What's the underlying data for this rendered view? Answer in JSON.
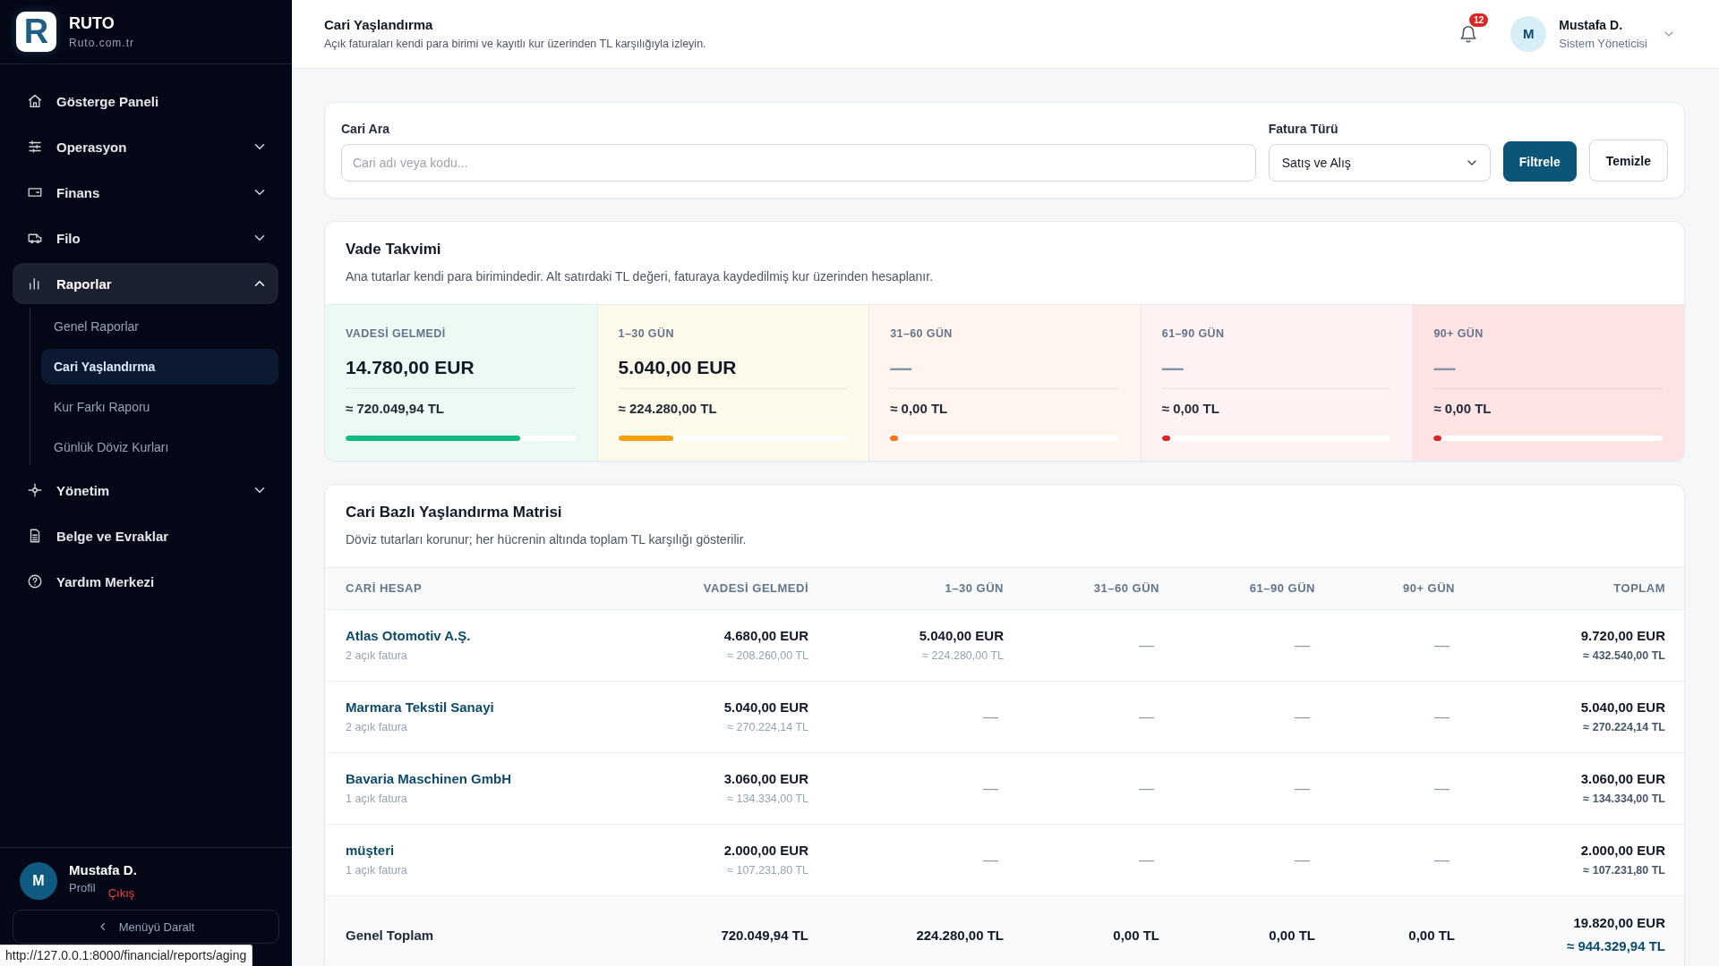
{
  "sidebar": {
    "brand": {
      "logo_letter": "R",
      "name": "RUTO",
      "domain": "Ruto.com.tr"
    },
    "items": [
      {
        "kind": "link",
        "label": "Gösterge Paneli",
        "selected": false
      },
      {
        "kind": "group",
        "label": "Operasyon",
        "selected": false,
        "expanded": false
      },
      {
        "kind": "group",
        "label": "Finans",
        "selected": false,
        "expanded": false
      },
      {
        "kind": "group",
        "label": "Filo",
        "selected": false,
        "expanded": false
      },
      {
        "kind": "group",
        "label": "Raporlar",
        "selected": true,
        "expanded": true,
        "children": [
          {
            "label": "Genel Raporlar",
            "selected": false
          },
          {
            "label": "Cari Yaşlandırma",
            "selected": true
          },
          {
            "label": "Kur Farkı Raporu",
            "selected": false
          },
          {
            "label": "Günlük Döviz Kurları",
            "selected": false
          }
        ]
      },
      {
        "kind": "group",
        "label": "Yönetim",
        "selected": false,
        "expanded": false
      },
      {
        "kind": "link",
        "label": "Belge ve Evraklar",
        "selected": false
      },
      {
        "kind": "link",
        "label": "Yardım Merkezi",
        "selected": false
      }
    ],
    "user": {
      "initial": "M",
      "name": "Mustafa D.",
      "profile_link": "Profil",
      "logout_link": "Çıkış"
    },
    "collapse_button": "Menüyü Daralt"
  },
  "header": {
    "title": "Cari Yaşlandırma",
    "subtitle": "Açık faturaları kendi para birimi ve kayıtlı kur üzerinden TL karşılığıyla izleyin.",
    "notifications": {
      "count": "12"
    },
    "user": {
      "initial": "M",
      "name": "Mustafa D.",
      "role": "Sistem Yöneticisi"
    }
  },
  "filters": {
    "search": {
      "label": "Cari Ara",
      "placeholder": "Cari adı veya kodu..."
    },
    "invoice_type": {
      "label": "Fatura Türü",
      "value": "Satış ve Alış"
    },
    "buttons": [
      {
        "label": "Filtrele",
        "kind": "primary"
      },
      {
        "label": "Temizle",
        "kind": "secondary"
      }
    ]
  },
  "schedule": {
    "title": "Vade Takvimi",
    "description": "Ana tutarlar kendi para birimindedir. Alt satırdaki TL değeri, faturaya kaydedilmiş kur üzerinden hesaplanır.",
    "buckets": [
      {
        "label": "VADESİ GELMEDİ",
        "amount": "14.780,00 EUR",
        "empty": false,
        "tl": "≈ 720.049,94 TL",
        "level": 0.76,
        "color": "#10b981"
      },
      {
        "label": "1–30 GÜN",
        "amount": "5.040,00 EUR",
        "empty": false,
        "tl": "≈ 224.280,00 TL",
        "level": 0.24,
        "color": "#f59e0b"
      },
      {
        "label": "31–60 GÜN",
        "amount": "—",
        "empty": true,
        "tl": "≈ 0,00 TL",
        "level": 0,
        "color": "#f97316"
      },
      {
        "label": "61–90 GÜN",
        "amount": "—",
        "empty": true,
        "tl": "≈ 0,00 TL",
        "level": 0,
        "color": "#dc2626"
      },
      {
        "label": "90+ GÜN",
        "amount": "—",
        "empty": true,
        "tl": "≈ 0,00 TL",
        "level": 0,
        "color": "#dc2626"
      }
    ]
  },
  "matrix": {
    "title": "Cari Bazlı Yaşlandırma Matrisi",
    "description": "Döviz tutarları korunur; her hücrenin altında toplam TL karşılığı gösterilir.",
    "columns": [
      "CARİ HESAP",
      "VADESİ GELMEDİ",
      "1–30 GÜN",
      "31–60 GÜN",
      "61–90 GÜN",
      "90+ GÜN",
      "TOPLAM"
    ],
    "rows": [
      {
        "cells": [
          {
            "kind": "account",
            "name": "Atlas Otomotiv A.Ş.",
            "invoices": "2 açık fatura"
          },
          {
            "kind": "amount",
            "amount": "4.680,00 EUR",
            "tl": "≈ 208.260,00 TL",
            "empty": false
          },
          {
            "kind": "amount",
            "amount": "5.040,00 EUR",
            "tl": "≈ 224.280,00 TL",
            "empty": false
          },
          {
            "kind": "amount",
            "amount": "—",
            "empty": true
          },
          {
            "kind": "amount",
            "amount": "—",
            "empty": true
          },
          {
            "kind": "amount",
            "amount": "—",
            "empty": true
          },
          {
            "kind": "total",
            "amount": "9.720,00 EUR",
            "tl": "≈ 432.540,00 TL"
          }
        ]
      },
      {
        "cells": [
          {
            "kind": "account",
            "name": "Marmara Tekstil Sanayi",
            "invoices": "2 açık fatura"
          },
          {
            "kind": "amount",
            "amount": "5.040,00 EUR",
            "tl": "≈ 270.224,14 TL",
            "empty": false
          },
          {
            "kind": "amount",
            "amount": "—",
            "empty": true
          },
          {
            "kind": "amount",
            "amount": "—",
            "empty": true
          },
          {
            "kind": "amount",
            "amount": "—",
            "empty": true
          },
          {
            "kind": "amount",
            "amount": "—",
            "empty": true
          },
          {
            "kind": "total",
            "amount": "5.040,00 EUR",
            "tl": "≈ 270.224,14 TL"
          }
        ]
      },
      {
        "cells": [
          {
            "kind": "account",
            "name": "Bavaria Maschinen GmbH",
            "invoices": "1 açık fatura"
          },
          {
            "kind": "amount",
            "amount": "3.060,00 EUR",
            "tl": "≈ 134.334,00 TL",
            "empty": false
          },
          {
            "kind": "amount",
            "amount": "—",
            "empty": true
          },
          {
            "kind": "amount",
            "amount": "—",
            "empty": true
          },
          {
            "kind": "amount",
            "amount": "—",
            "empty": true
          },
          {
            "kind": "amount",
            "amount": "—",
            "empty": true
          },
          {
            "kind": "total",
            "amount": "3.060,00 EUR",
            "tl": "≈ 134.334,00 TL"
          }
        ]
      },
      {
        "cells": [
          {
            "kind": "account",
            "name": "müşteri",
            "invoices": "1 açık fatura"
          },
          {
            "kind": "amount",
            "amount": "2.000,00 EUR",
            "tl": "≈ 107.231,80 TL",
            "empty": false
          },
          {
            "kind": "amount",
            "amount": "—",
            "empty": true
          },
          {
            "kind": "amount",
            "amount": "—",
            "empty": true
          },
          {
            "kind": "amount",
            "amount": "—",
            "empty": true
          },
          {
            "kind": "amount",
            "amount": "—",
            "empty": true
          },
          {
            "kind": "total",
            "amount": "2.000,00 EUR",
            "tl": "≈ 107.231,80 TL"
          }
        ]
      }
    ],
    "footer": {
      "cells": [
        {
          "kind": "label",
          "text": "Genel Toplam"
        },
        {
          "kind": "value",
          "text": "720.049,94 TL"
        },
        {
          "kind": "value",
          "text": "224.280,00 TL"
        },
        {
          "kind": "value",
          "text": "0,00 TL"
        },
        {
          "kind": "value",
          "text": "0,00 TL"
        },
        {
          "kind": "value",
          "text": "0,00 TL"
        },
        {
          "kind": "grand_total",
          "amount": "19.820,00 EUR",
          "tl": "≈ 944.329,94 TL"
        }
      ]
    }
  },
  "browser_status": {
    "url": "http://127.0.0.1:8000/financial/reports/aging"
  }
}
